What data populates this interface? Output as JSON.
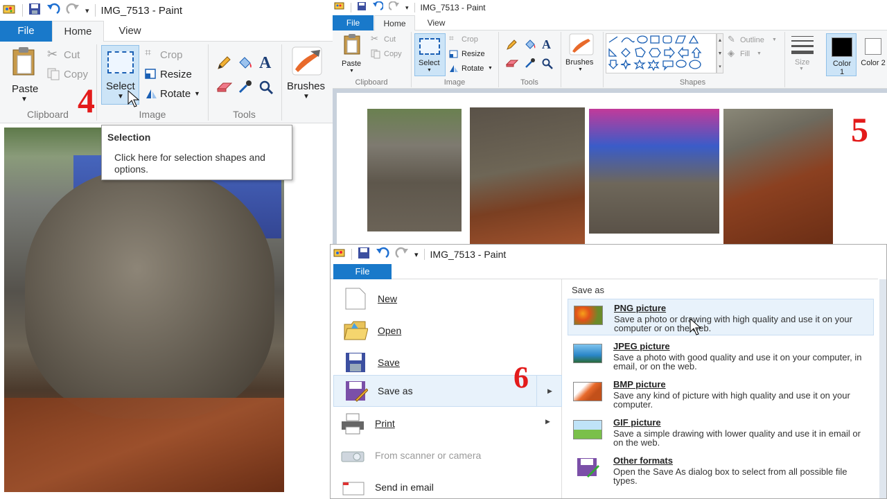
{
  "panel4": {
    "title": "IMG_7513 - Paint",
    "tabs": {
      "file": "File",
      "home": "Home",
      "view": "View"
    },
    "clipboard": {
      "paste": "Paste",
      "cut": "Cut",
      "copy": "Copy",
      "label": "Clipboard"
    },
    "image": {
      "select": "Select",
      "crop": "Crop",
      "resize": "Resize",
      "rotate": "Rotate",
      "label": "Image"
    },
    "tools": {
      "label": "Tools"
    },
    "brushes": "Brushes",
    "step": "4",
    "tooltip": {
      "title": "Selection",
      "body": "Click here for selection shapes and options."
    }
  },
  "panel5": {
    "title": "IMG_7513 - Paint",
    "tabs": {
      "file": "File",
      "home": "Home",
      "view": "View"
    },
    "clipboard": {
      "paste": "Paste",
      "cut": "Cut",
      "copy": "Copy",
      "label": "Clipboard"
    },
    "image": {
      "select": "Select",
      "crop": "Crop",
      "resize": "Resize",
      "rotate": "Rotate",
      "label": "Image"
    },
    "tools": {
      "label": "Tools"
    },
    "brushes": "Brushes",
    "shapes": {
      "label": "Shapes",
      "outline": "Outline",
      "fill": "Fill"
    },
    "size": "Size",
    "color1": "Color 1",
    "color2": "Color 2",
    "step": "5"
  },
  "panel6": {
    "title": "IMG_7513 - Paint",
    "file_tab": "File",
    "menu": [
      "New",
      "Open",
      "Save",
      "Save as",
      "Print",
      "From scanner or camera",
      "Send in email"
    ],
    "save_as_header": "Save as",
    "formats": [
      {
        "title": "PNG picture",
        "desc": "Save a photo or drawing with high quality and use it on your computer or on the web."
      },
      {
        "title": "JPEG picture",
        "desc": "Save a photo with good quality and use it on your computer, in email, or on the web."
      },
      {
        "title": "BMP picture",
        "desc": "Save any kind of picture with high quality and use it on your computer."
      },
      {
        "title": "GIF picture",
        "desc": "Save a simple drawing with lower quality and use it in email or on the web."
      },
      {
        "title": "Other formats",
        "desc": "Open the Save As dialog box to select from all possible file types."
      }
    ],
    "step": "6"
  },
  "colors": {
    "file_tab": "#1979ca",
    "ribbon": "#f5f6f7",
    "selected": "#cce4f7",
    "step": "#e31b1b",
    "canvas": "#c8d1dc"
  }
}
